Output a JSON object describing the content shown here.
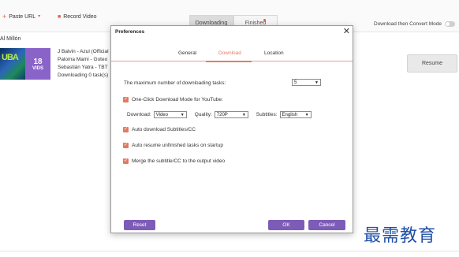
{
  "toolbar": {
    "paste_url": "Paste URL",
    "record_video": "Record Video",
    "tab_downloading": "Downloading",
    "tab_finished": "Finished",
    "download_then_convert": "Download then Convert Mode"
  },
  "list": {
    "title": "Al Millón",
    "thumb_count": "18",
    "thumb_unit": "VIDS",
    "thumb_text": "UBA",
    "lines": [
      "J Balvin - Azul (Official",
      "Paloma Mami - Goteo",
      "Sebastián Yatra - TBT",
      "Downloading 0 task(s)"
    ],
    "resume": "Resume"
  },
  "dialog": {
    "title": "Preferences",
    "tabs": [
      "General",
      "Download",
      "Location"
    ],
    "active_tab": "Download",
    "max_tasks_label": "The maximum number of downloading tasks:",
    "max_tasks_value": "5",
    "one_click_label": "One-Click Download Mode for YouTube:",
    "download_label": "Download:",
    "download_value": "Video",
    "quality_label": "Quality:",
    "quality_value": "720P",
    "subtitles_label": "Subtitles:",
    "subtitles_value": "English",
    "opt_auto_subs": "Auto download Subtitles/CC",
    "opt_auto_resume": "Auto resume unfinished tasks on startup",
    "opt_merge": "Merge the subtitle/CC to the output video",
    "reset": "Reset",
    "ok": "OK",
    "cancel": "Cancel"
  },
  "watermark": "最需教育",
  "colors": {
    "accent": "#e07b63",
    "button": "#7d5cb8"
  }
}
